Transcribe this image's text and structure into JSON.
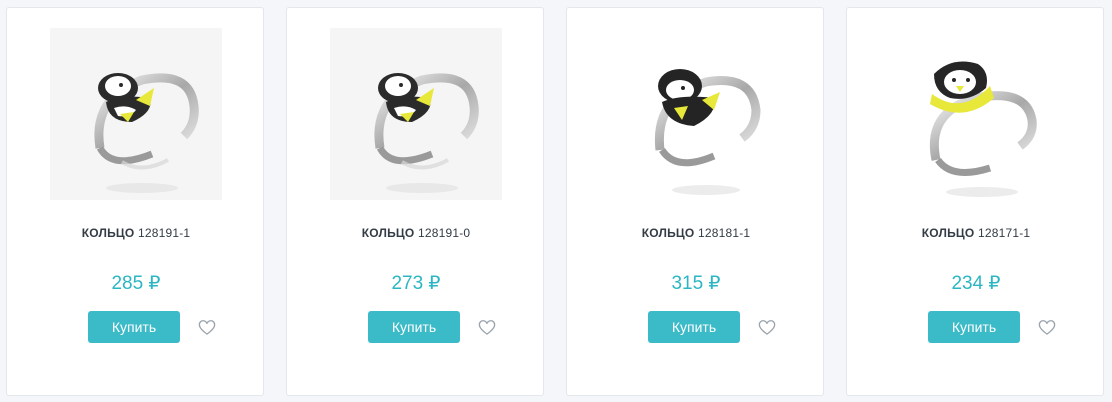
{
  "currency_symbol": "₽",
  "colors": {
    "accent": "#3bbbc8",
    "price": "#2bb6c3",
    "card_border": "#e3e6ea",
    "page_background": "#f4f6f9"
  },
  "products": [
    {
      "title_word": "КОЛЬЦО",
      "code": "128191-1",
      "price": "285 ₽",
      "buy_label": "Купить",
      "icon": "heart-outline-icon"
    },
    {
      "title_word": "КОЛЬЦО",
      "code": "128191-0",
      "price": "273 ₽",
      "buy_label": "Купить",
      "icon": "heart-outline-icon"
    },
    {
      "title_word": "КОЛЬЦО",
      "code": "128181-1",
      "price": "315 ₽",
      "buy_label": "Купить",
      "icon": "heart-outline-icon"
    },
    {
      "title_word": "КОЛЬЦО",
      "code": "128171-1",
      "price": "234 ₽",
      "buy_label": "Купить",
      "icon": "heart-outline-icon"
    }
  ]
}
